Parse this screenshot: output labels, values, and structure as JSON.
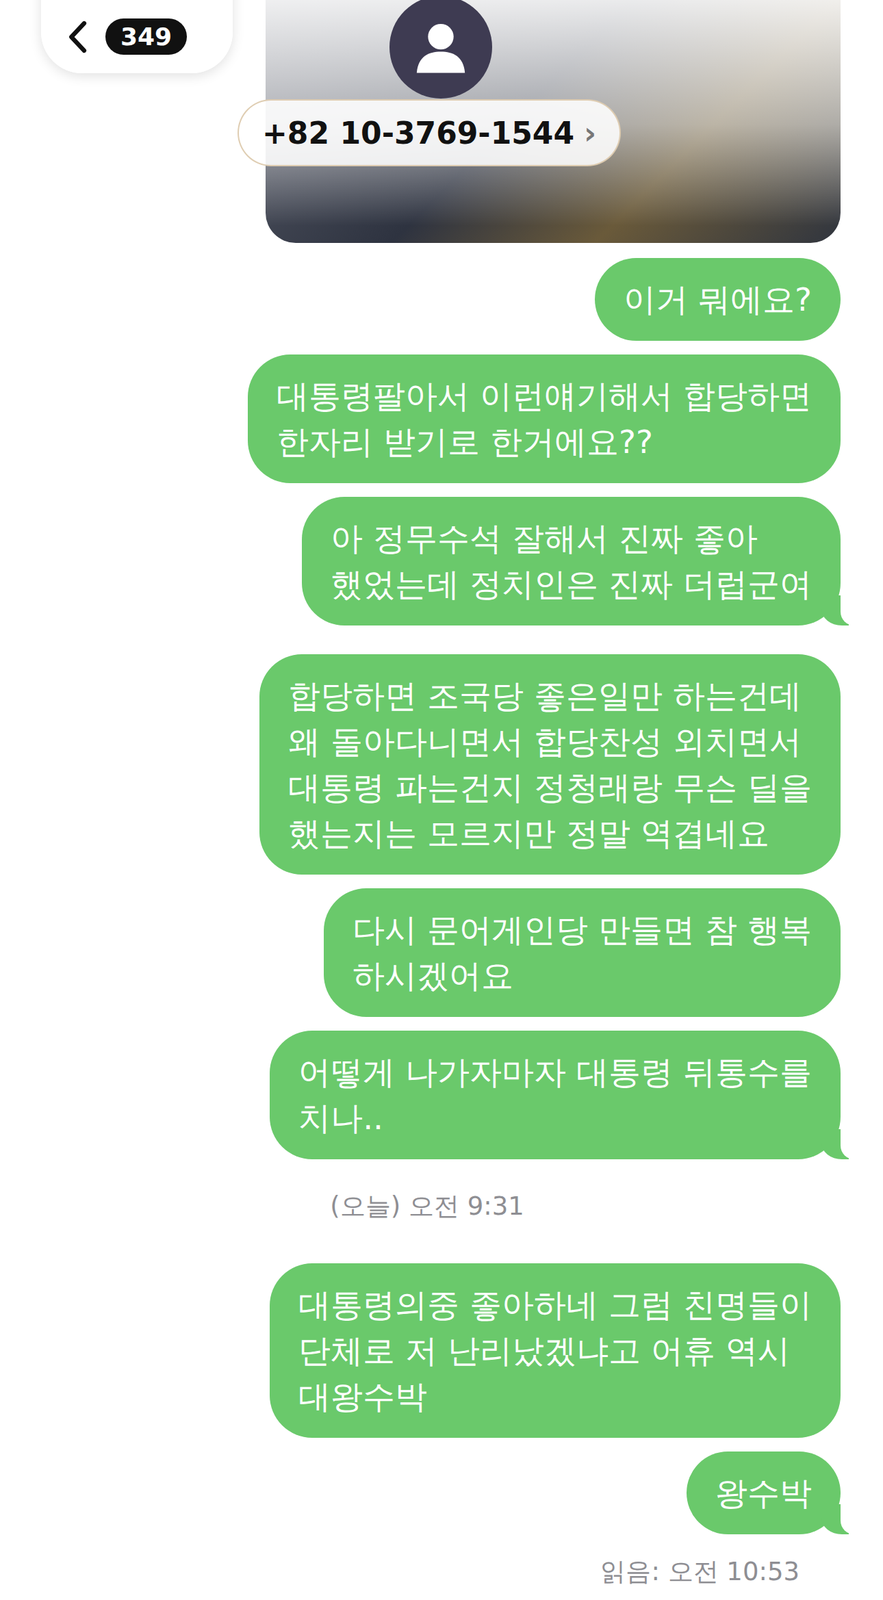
{
  "header": {
    "back_count": "349",
    "contact": "+82 10-3769-1544",
    "contact_chevron": "›"
  },
  "messages": [
    {
      "kind": "bubble",
      "lines": [
        "이거 뭐에요?"
      ],
      "tail": false
    },
    {
      "kind": "bubble",
      "lines": [
        "대통령팔아서 이런얘기해서 합당하면",
        "한자리 받기로 한거에요??"
      ],
      "tail": false
    },
    {
      "kind": "bubble",
      "lines": [
        "아 정무수석 잘해서 진짜 좋아",
        "했었는데 정치인은 진짜 더럽군여"
      ],
      "tail": true
    },
    {
      "kind": "bubble",
      "lines": [
        "합당하면 조국당 좋은일만 하는건데",
        "왜 돌아다니면서 합당찬성 외치면서",
        "대통령 파는건지 정청래랑 무슨 딜을",
        "했는지는 모르지만 정말 역겹네요"
      ],
      "tail": false
    },
    {
      "kind": "bubble",
      "lines": [
        "다시 문어게인당 만들면 참 행복",
        "하시겠어요"
      ],
      "tail": false
    },
    {
      "kind": "bubble",
      "lines": [
        "어떻게 나가자마자 대통령 뒤통수를",
        "치나.."
      ],
      "tail": true
    },
    {
      "kind": "timestamp",
      "text": "(오늘) 오전 9:31"
    },
    {
      "kind": "bubble",
      "lines": [
        "대통령의중 좋아하네 그럼 친명들이",
        "단체로 저 난리났겠냐고 어휴 역시",
        "대왕수박"
      ],
      "tail": false
    },
    {
      "kind": "bubble",
      "lines": [
        "왕수박"
      ],
      "tail": true
    }
  ],
  "read_receipt": "읽음: 오전 10:53"
}
